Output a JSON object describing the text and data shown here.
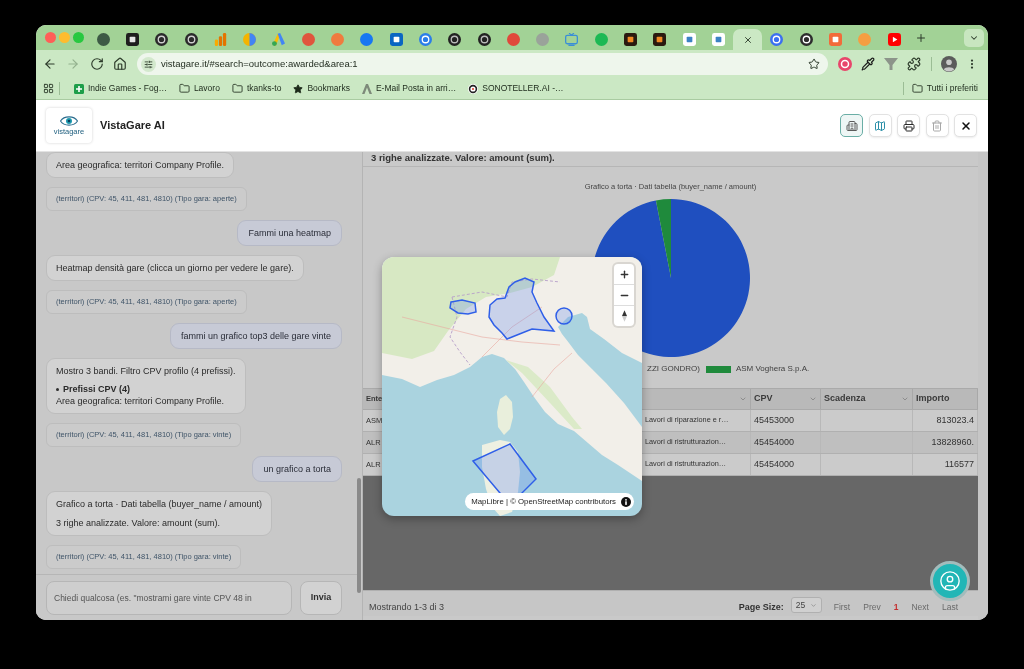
{
  "browser": {
    "tabs": [
      {
        "selected": false
      },
      {
        "selected": false
      },
      {
        "selected": false
      },
      {
        "selected": false
      },
      {
        "selected": false
      },
      {
        "selected": false
      },
      {
        "selected": false
      },
      {
        "selected": false
      },
      {
        "selected": false
      },
      {
        "selected": false
      },
      {
        "selected": false
      },
      {
        "selected": false
      },
      {
        "selected": false
      },
      {
        "selected": false
      },
      {
        "selected": false
      },
      {
        "selected": false
      },
      {
        "selected": false
      },
      {
        "selected": false
      },
      {
        "selected": false
      },
      {
        "selected": false
      },
      {
        "selected": false
      },
      {
        "selected": false
      },
      {
        "selected": true
      },
      {
        "selected": false
      },
      {
        "selected": false
      },
      {
        "selected": false
      },
      {
        "selected": false
      },
      {
        "selected": false
      }
    ],
    "nav": [
      {
        "kind": "back",
        "disabled": false
      },
      {
        "kind": "forward",
        "disabled": true
      },
      {
        "kind": "reload",
        "disabled": false
      },
      {
        "kind": "home",
        "disabled": false
      }
    ],
    "url": "vistagare.it/#search=outcome:awarded&area:1",
    "bookmarks": [
      {
        "kind": "site",
        "label": "Indie Games - Fog…"
      },
      {
        "kind": "folder",
        "label": "Lavoro"
      },
      {
        "kind": "folder",
        "label": "tkanks-to"
      },
      {
        "kind": "starred",
        "label": "Bookmarks"
      },
      {
        "kind": "mail",
        "label": "E-Mail Posta in arri…"
      },
      {
        "kind": "logo",
        "label": "SONOTELLER.AI -…"
      }
    ],
    "all_bookmarks": "Tutti i preferiti"
  },
  "header": {
    "logo_text": "vistagare",
    "title": "VistaGare AI",
    "buttons": [
      {
        "kind": "building",
        "selected": true
      },
      {
        "kind": "map",
        "selected": false
      },
      {
        "kind": "print",
        "selected": false
      },
      {
        "kind": "delete",
        "selected": false
      },
      {
        "kind": "close",
        "selected": false
      }
    ]
  },
  "chat": {
    "messages": [
      {
        "kind": "assistant",
        "lines": [
          {
            "kind": "text",
            "text": "Area geografica: territori Company Profile."
          }
        ]
      },
      {
        "kind": "meta",
        "text": "(territori) (CPV: 45, 411, 481, 4810) (Tipo gara: aperte)"
      },
      {
        "kind": "user",
        "text": "Fammi una heatmap"
      },
      {
        "kind": "assistant",
        "lines": [
          {
            "kind": "text",
            "text": "Heatmap densità gare (clicca un giorno per vedere le gare)."
          }
        ]
      },
      {
        "kind": "meta",
        "text": "(territori) (CPV: 45, 411, 481, 4810) (Tipo gara: aperte)"
      },
      {
        "kind": "user",
        "text": "fammi un grafico top3 delle gare vinte"
      },
      {
        "kind": "assistant",
        "lines": [
          {
            "kind": "text",
            "text": "Mostro 3 bandi. Filtro CPV profilo (4 prefissi)."
          },
          {
            "kind": "bullet",
            "text": "Prefissi CPV (4)"
          },
          {
            "kind": "text",
            "text": "Area geografica: territori Company Profile."
          }
        ]
      },
      {
        "kind": "meta",
        "text": "(territori) (CPV: 45, 411, 481, 4810) (Tipo gara: vinte)"
      },
      {
        "kind": "user",
        "text": "un grafico a torta"
      },
      {
        "kind": "assistant",
        "lines": [
          {
            "kind": "text",
            "text": "Grafico a torta · Dati tabella (buyer_name / amount)"
          },
          {
            "kind": "text",
            "text": "3 righe analizzate. Valore: amount (sum)."
          }
        ]
      },
      {
        "kind": "meta",
        "text": "(territori) (CPV: 45, 411, 481, 4810) (Tipo gara: vinte)"
      }
    ],
    "input": {
      "placeholder": "Chiedi qualcosa (es. \"mostrami gare vinte CPV 48 in"
    },
    "send": "Invia"
  },
  "results": {
    "summary": "3 righe analizzate. Valore: amount (sum).",
    "chart": {
      "title": "Grafico a torta · Dati tabella (buyer_name / amount)",
      "slices": [
        {
          "color": "#1f4fbf"
        },
        {
          "color": "#1f8a3c"
        }
      ],
      "legend": [
        {
          "label": "ZZI GONDRO)"
        },
        {
          "label": "ASM Voghera S.p.A.",
          "color": "#1f8a3c"
        }
      ]
    },
    "table": {
      "columns": [
        "Ente",
        null,
        "CPV",
        "Scadenza",
        "Importo"
      ],
      "rows": [
        [
          "ASM",
          "Lavori di riparazione e r…",
          "45453000",
          null,
          "813023.4"
        ],
        [
          "ALR",
          "Lavori di ristrutturazion…",
          "45454000",
          null,
          "13828960."
        ],
        [
          "ALR",
          "Lavori di ristrutturazion…",
          "45454000",
          null,
          "116577"
        ]
      ]
    },
    "footer": {
      "status": "Mostrando 1-3 di 3",
      "page_size_label": "Page Size:",
      "page_size": "25",
      "pager": [
        {
          "label": "First",
          "selected": false,
          "disabled": true
        },
        {
          "label": "Prev",
          "selected": false,
          "disabled": true
        },
        {
          "label": "1",
          "selected": true,
          "disabled": false
        },
        {
          "label": "Next",
          "selected": false,
          "disabled": true
        },
        {
          "label": "Last",
          "selected": false,
          "disabled": true
        }
      ]
    }
  },
  "map": {
    "attribution": "MapLibre | © OpenStreetMap contributors"
  }
}
